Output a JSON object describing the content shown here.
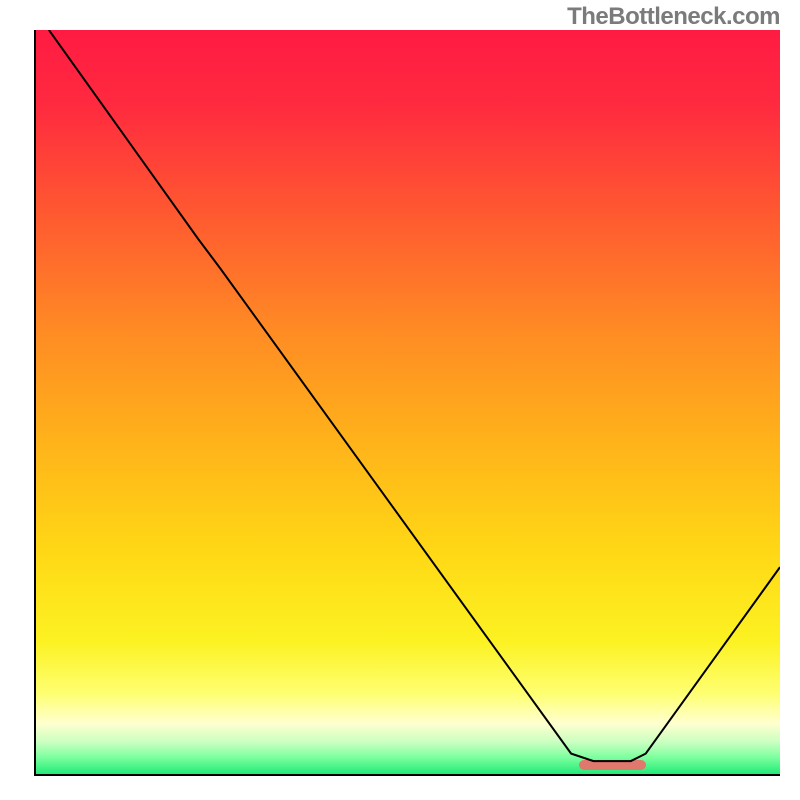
{
  "watermark": "TheBottleneck.com",
  "colors": {
    "gradient_stops": [
      {
        "offset": 0.0,
        "color": "#ff1b43"
      },
      {
        "offset": 0.1,
        "color": "#ff2a3f"
      },
      {
        "offset": 0.25,
        "color": "#ff5a30"
      },
      {
        "offset": 0.4,
        "color": "#ff8a24"
      },
      {
        "offset": 0.55,
        "color": "#ffb21a"
      },
      {
        "offset": 0.7,
        "color": "#ffd815"
      },
      {
        "offset": 0.82,
        "color": "#fcf222"
      },
      {
        "offset": 0.89,
        "color": "#feff72"
      },
      {
        "offset": 0.93,
        "color": "#ffffd0"
      },
      {
        "offset": 0.955,
        "color": "#c9ffc0"
      },
      {
        "offset": 0.975,
        "color": "#7dff9e"
      },
      {
        "offset": 1.0,
        "color": "#16e873"
      }
    ],
    "bar": "#e0786e",
    "axis": "#000000"
  },
  "chart_data": {
    "type": "line",
    "title": "",
    "xlabel": "",
    "ylabel": "",
    "xlim": [
      0,
      100
    ],
    "ylim": [
      0,
      100
    ],
    "series": [
      {
        "name": "bottleneck-curve",
        "points": [
          {
            "x": 2,
            "y": 100
          },
          {
            "x": 22,
            "y": 72
          },
          {
            "x": 25,
            "y": 68
          },
          {
            "x": 72,
            "y": 3
          },
          {
            "x": 75,
            "y": 2
          },
          {
            "x": 80,
            "y": 2
          },
          {
            "x": 82,
            "y": 3
          },
          {
            "x": 100,
            "y": 28
          }
        ]
      }
    ],
    "annotations": [
      {
        "name": "optimal-bar",
        "x_start": 73,
        "x_end": 82,
        "y": 1.5,
        "color": "#e0786e"
      }
    ],
    "grid": false,
    "legend": false
  }
}
